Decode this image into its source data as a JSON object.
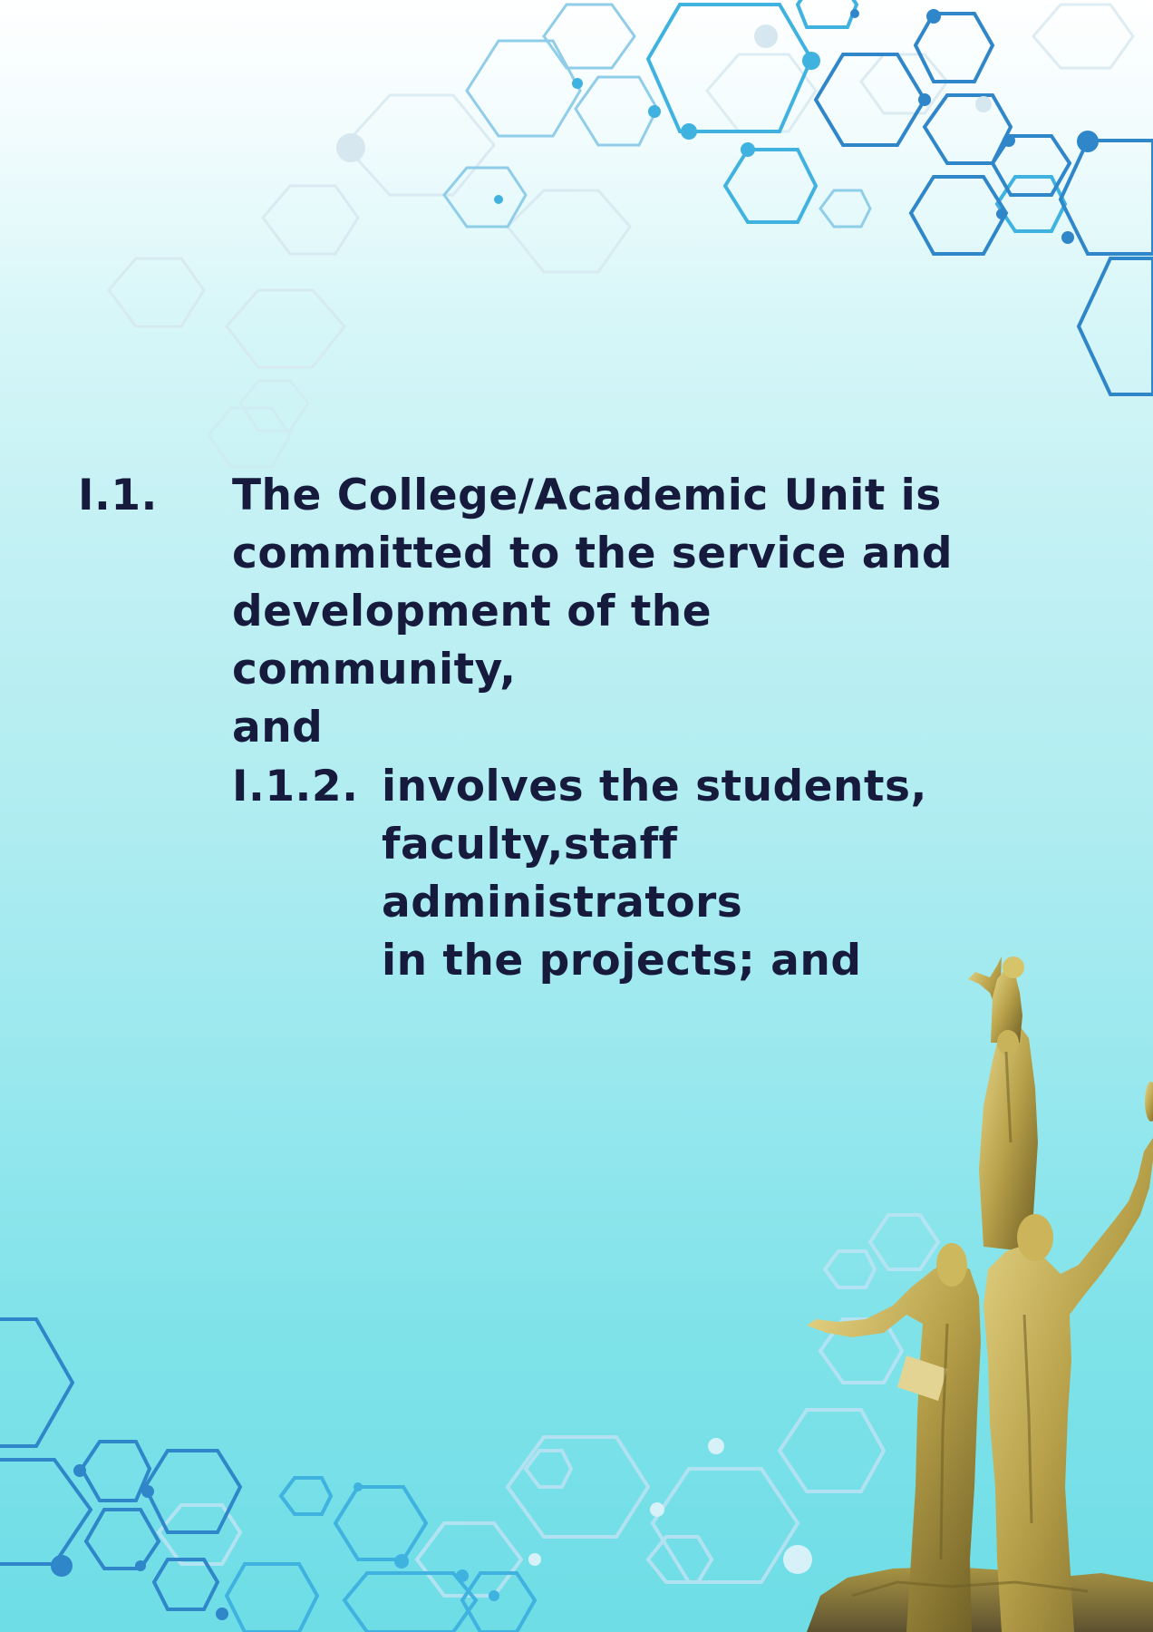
{
  "colors": {
    "text": "#161b3d",
    "hex_dark": "#2f86c8",
    "hex_mid": "#3fb2e0",
    "hex_light": "#b9e3f3",
    "statue_gold": "#b8a14a"
  },
  "items": [
    {
      "number": "I.1.",
      "text": "The College/Academic Unit is\ncommitted to the service and\ndevelopment of the community,\nand"
    },
    {
      "number": "I.1.2.",
      "text": "involves the students,\nfaculty,staff administrators\nin the projects; and"
    }
  ],
  "decorations": [
    "hexagon-network-pattern",
    "golden-monument-statue"
  ]
}
